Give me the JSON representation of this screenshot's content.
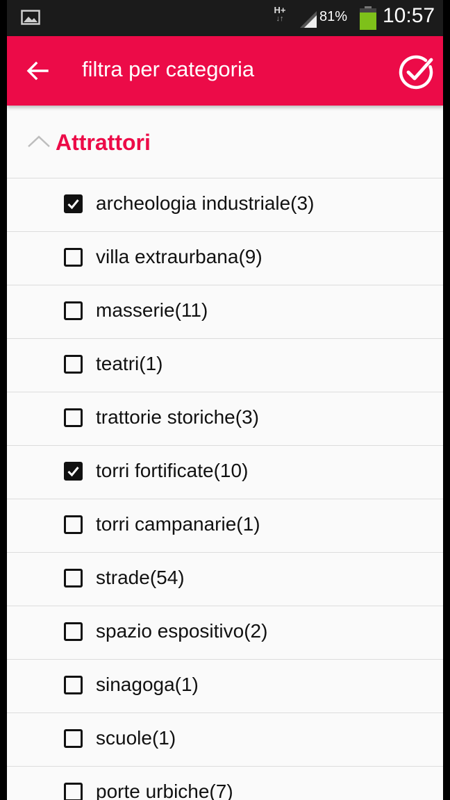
{
  "status_bar": {
    "network": "H+",
    "battery_percent": "81%",
    "battery_level": 0.81,
    "time": "10:57"
  },
  "toolbar": {
    "title": "filtra per categoria",
    "back_icon": "arrow-left-icon",
    "confirm_icon": "check-circle-icon"
  },
  "group": {
    "title": "Attrattori",
    "expanded": true
  },
  "items": [
    {
      "label": "archeologia industriale(3)",
      "checked": true
    },
    {
      "label": "villa extraurbana(9)",
      "checked": false
    },
    {
      "label": "masserie(11)",
      "checked": false
    },
    {
      "label": "teatri(1)",
      "checked": false
    },
    {
      "label": "trattorie storiche(3)",
      "checked": false
    },
    {
      "label": "torri fortificate(10)",
      "checked": true
    },
    {
      "label": "torri campanarie(1)",
      "checked": false
    },
    {
      "label": "strade(54)",
      "checked": false
    },
    {
      "label": "spazio espositivo(2)",
      "checked": false
    },
    {
      "label": "sinagoga(1)",
      "checked": false
    },
    {
      "label": "scuole(1)",
      "checked": false
    },
    {
      "label": "porte urbiche(7)",
      "checked": false
    }
  ],
  "colors": {
    "accent": "#ec0b48",
    "status_bar": "#1b1b1b",
    "battery": "#7ec11a"
  }
}
